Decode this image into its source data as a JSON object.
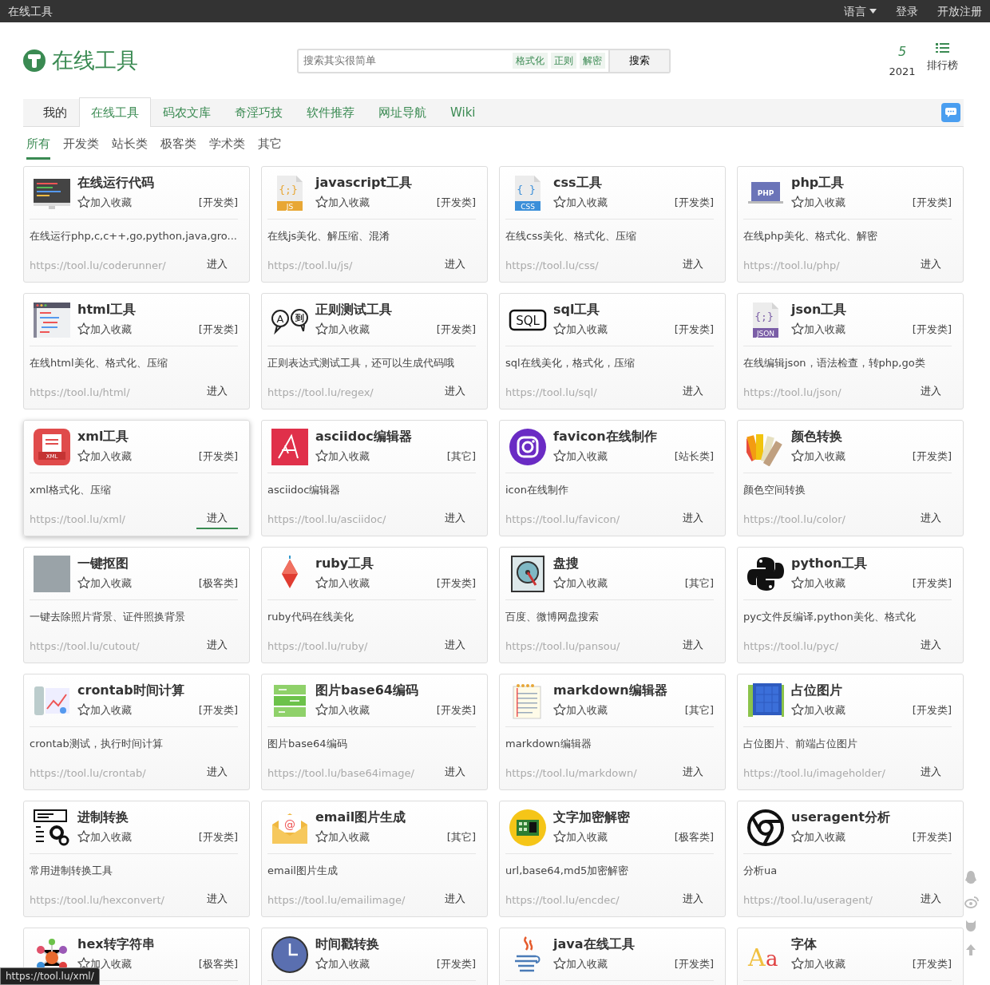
{
  "topbar": {
    "title": "在线工具",
    "links": [
      {
        "label": "语言",
        "dropdown": true
      },
      {
        "label": "登录",
        "dropdown": false
      },
      {
        "label": "开放注册",
        "dropdown": false
      }
    ]
  },
  "brand": {
    "name": "在线工具"
  },
  "search": {
    "placeholder": "搜索其实很简单",
    "tags": [
      "格式化",
      "正则",
      "解密"
    ],
    "button": "搜索"
  },
  "stats": [
    {
      "kind": "number",
      "value": "5",
      "label": "2021"
    },
    {
      "kind": "ranking",
      "label": "排行榜"
    }
  ],
  "tabs": [
    {
      "label": "我的",
      "selected": false
    },
    {
      "label": "在线工具",
      "selected": true
    },
    {
      "label": "码农文库",
      "selected": false
    },
    {
      "label": "奇淫巧技",
      "selected": false
    },
    {
      "label": "软件推荐",
      "selected": false
    },
    {
      "label": "网址导航",
      "selected": false
    },
    {
      "label": "Wiki",
      "selected": false
    }
  ],
  "filters": [
    {
      "label": "所有",
      "selected": true
    },
    {
      "label": "开发类",
      "selected": false
    },
    {
      "label": "站长类",
      "selected": false
    },
    {
      "label": "极客类",
      "selected": false
    },
    {
      "label": "学术类",
      "selected": false
    },
    {
      "label": "其它",
      "selected": false
    }
  ],
  "cards": [
    {
      "title": "在线运行代码",
      "favorite": "加入收藏",
      "category": "[开发类]",
      "description": "在线运行php,c,c++,go,python,java,gro...",
      "url": "https://tool.lu/coderunner/",
      "enter": "进入",
      "hovered": false
    },
    {
      "title": "javascript工具",
      "icon_labels": [
        "{;}",
        "JS"
      ],
      "favorite": "加入收藏",
      "category": "[开发类]",
      "description": "在线js美化、解压缩、混淆",
      "url": "https://tool.lu/js/",
      "enter": "进入",
      "hovered": false
    },
    {
      "title": "css工具",
      "icon_labels": [
        "{ }",
        "CSS"
      ],
      "favorite": "加入收藏",
      "category": "[开发类]",
      "description": "在线css美化、格式化、压缩",
      "url": "https://tool.lu/css/",
      "enter": "进入",
      "hovered": false
    },
    {
      "title": "php工具",
      "icon_labels": [
        "PHP"
      ],
      "favorite": "加入收藏",
      "category": "[开发类]",
      "description": "在线php美化、格式化、解密",
      "url": "https://tool.lu/php/",
      "enter": "进入",
      "hovered": false
    },
    {
      "title": "html工具",
      "favorite": "加入收藏",
      "category": "[开发类]",
      "description": "在线html美化、格式化、压缩",
      "url": "https://tool.lu/html/",
      "enter": "进入",
      "hovered": false
    },
    {
      "title": "正则测试工具",
      "icon_labels": [
        "A",
        "到"
      ],
      "favorite": "加入收藏",
      "category": "[开发类]",
      "description": "正则表达式测试工具，还可以生成代码哦",
      "url": "https://tool.lu/regex/",
      "enter": "进入",
      "hovered": false
    },
    {
      "title": "sql工具",
      "icon_labels": [
        "SQL"
      ],
      "favorite": "加入收藏",
      "category": "[开发类]",
      "description": "sql在线美化，格式化，压缩",
      "url": "https://tool.lu/sql/",
      "enter": "进入",
      "hovered": false
    },
    {
      "title": "json工具",
      "icon_labels": [
        "{;}",
        "JSON"
      ],
      "favorite": "加入收藏",
      "category": "[开发类]",
      "description": "在线编辑json，语法检查，转php,go类",
      "url": "https://tool.lu/json/",
      "enter": "进入",
      "hovered": false
    },
    {
      "title": "xml工具",
      "icon_labels": [
        "XML"
      ],
      "favorite": "加入收藏",
      "category": "[开发类]",
      "description": "xml格式化、压缩",
      "url": "https://tool.lu/xml/",
      "enter": "进入",
      "hovered": true
    },
    {
      "title": "asciidoc编辑器",
      "favorite": "加入收藏",
      "category": "[其它]",
      "description": "asciidoc编辑器",
      "url": "https://tool.lu/asciidoc/",
      "enter": "进入",
      "hovered": false
    },
    {
      "title": "favicon在线制作",
      "favorite": "加入收藏",
      "category": "[站长类]",
      "description": "icon在线制作",
      "url": "https://tool.lu/favicon/",
      "enter": "进入",
      "hovered": false
    },
    {
      "title": "颜色转换",
      "favorite": "加入收藏",
      "category": "[开发类]",
      "description": "颜色空间转换",
      "url": "https://tool.lu/color/",
      "enter": "进入",
      "hovered": false
    },
    {
      "title": "一键抠图",
      "favorite": "加入收藏",
      "category": "[极客类]",
      "description": "一键去除照片背景、证件照换背景",
      "url": "https://tool.lu/cutout/",
      "enter": "进入",
      "hovered": false
    },
    {
      "title": "ruby工具",
      "favorite": "加入收藏",
      "category": "[开发类]",
      "description": "ruby代码在线美化",
      "url": "https://tool.lu/ruby/",
      "enter": "进入",
      "hovered": false
    },
    {
      "title": "盘搜",
      "favorite": "加入收藏",
      "category": "[其它]",
      "description": "百度、微博网盘搜索",
      "url": "https://tool.lu/pansou/",
      "enter": "进入",
      "hovered": false
    },
    {
      "title": "python工具",
      "favorite": "加入收藏",
      "category": "[开发类]",
      "description": "pyc文件反编译,python美化、格式化",
      "url": "https://tool.lu/pyc/",
      "enter": "进入",
      "hovered": false
    },
    {
      "title": "crontab时间计算",
      "favorite": "加入收藏",
      "category": "[开发类]",
      "description": "crontab测试，执行时间计算",
      "url": "https://tool.lu/crontab/",
      "enter": "进入",
      "hovered": false
    },
    {
      "title": "图片base64编码",
      "favorite": "加入收藏",
      "category": "[开发类]",
      "description": "图片base64编码",
      "url": "https://tool.lu/base64image/",
      "enter": "进入",
      "hovered": false
    },
    {
      "title": "markdown编辑器",
      "favorite": "加入收藏",
      "category": "[其它]",
      "description": "markdown编辑器",
      "url": "https://tool.lu/markdown/",
      "enter": "进入",
      "hovered": false
    },
    {
      "title": "占位图片",
      "favorite": "加入收藏",
      "category": "[开发类]",
      "description": "占位图片、前端占位图片",
      "url": "https://tool.lu/imageholder/",
      "enter": "进入",
      "hovered": false
    },
    {
      "title": "进制转换",
      "favorite": "加入收藏",
      "category": "[开发类]",
      "description": "常用进制转换工具",
      "url": "https://tool.lu/hexconvert/",
      "enter": "进入",
      "hovered": false
    },
    {
      "title": "email图片生成",
      "icon_labels": [
        "@"
      ],
      "favorite": "加入收藏",
      "category": "[其它]",
      "description": "email图片生成",
      "url": "https://tool.lu/emailimage/",
      "enter": "进入",
      "hovered": false
    },
    {
      "title": "文字加密解密",
      "favorite": "加入收藏",
      "category": "[极客类]",
      "description": "url,base64,md5加密解密",
      "url": "https://tool.lu/encdec/",
      "enter": "进入",
      "hovered": false
    },
    {
      "title": "useragent分析",
      "favorite": "加入收藏",
      "category": "[开发类]",
      "description": "分析ua",
      "url": "https://tool.lu/useragent/",
      "enter": "进入",
      "hovered": false
    },
    {
      "title": "hex转字符串",
      "favorite": "加入收藏",
      "category": "[极客类]",
      "hovered": false
    },
    {
      "title": "时间戳转换",
      "favorite": "加入收藏",
      "category": "[开发类]",
      "hovered": false
    },
    {
      "title": "java在线工具",
      "favorite": "加入收藏",
      "category": "[开发类]",
      "hovered": false
    },
    {
      "title": "字体",
      "icon_labels": [
        "Aa"
      ],
      "favorite": "加入收藏",
      "category": "[开发类]",
      "hovered": false
    }
  ],
  "status_bar": {
    "url": "https://tool.lu/xml/"
  }
}
